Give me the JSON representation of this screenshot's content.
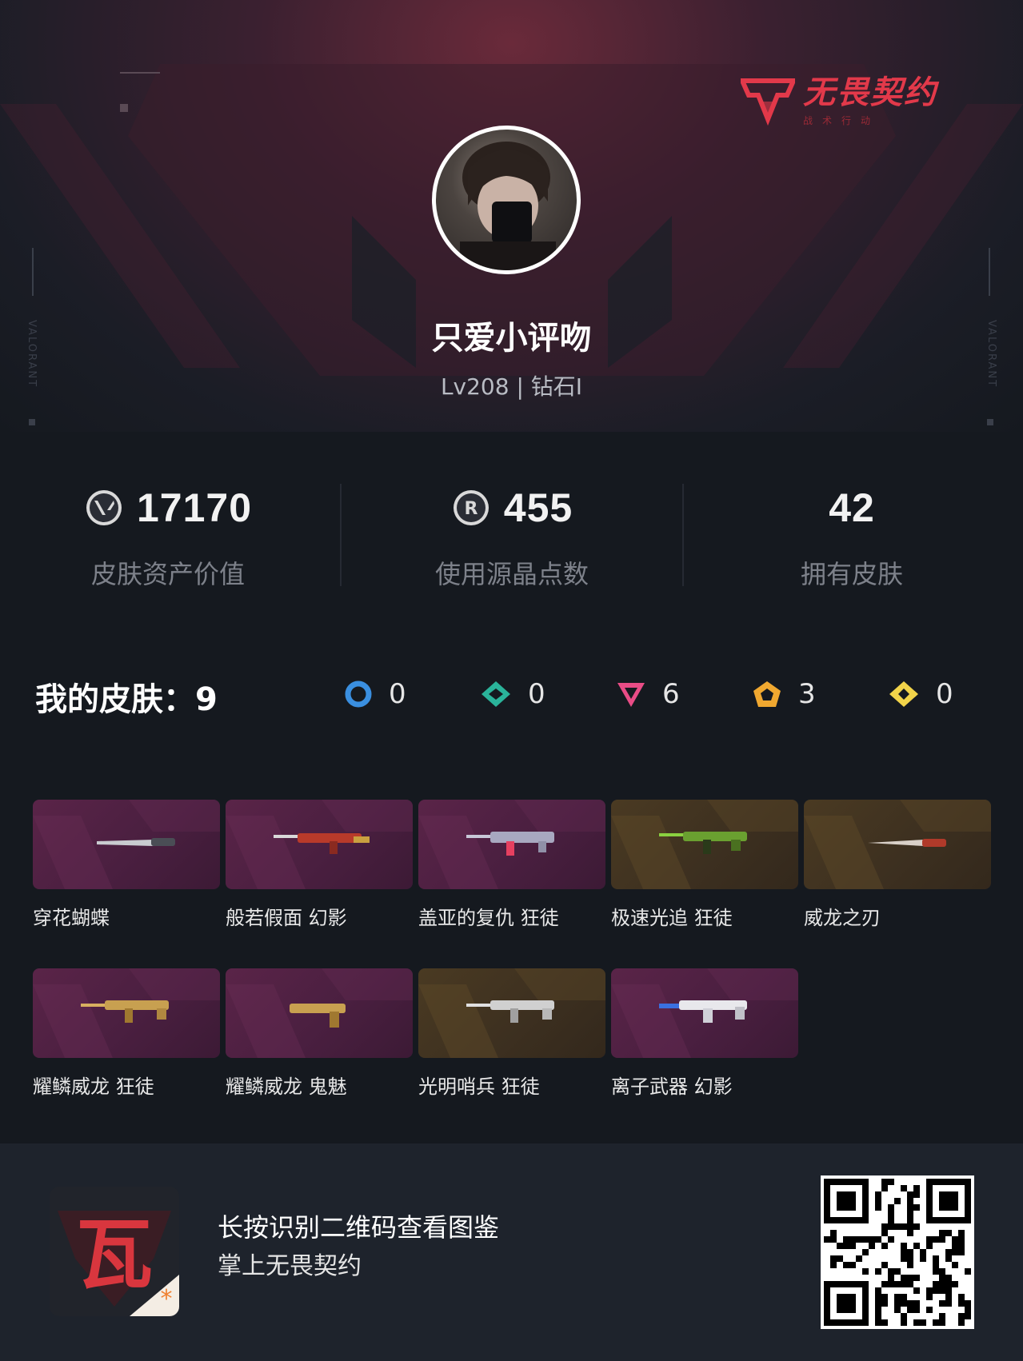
{
  "brand": {
    "title": "无畏契约",
    "subtitle": "战术行动"
  },
  "side_text": "VALORANT",
  "profile": {
    "username": "只爱小评吻",
    "level": "Lv208 | 钻石I"
  },
  "stats": [
    {
      "value": "17170",
      "label": "皮肤资产价值",
      "icon": "valorant-points-icon"
    },
    {
      "value": "455",
      "label": "使用源晶点数",
      "icon": "radianite-points-icon"
    },
    {
      "value": "42",
      "label": "拥有皮肤",
      "icon": ""
    }
  ],
  "skins_section": {
    "title": "我的皮肤：9",
    "rarities": [
      {
        "icon": "select-tier-icon",
        "color": "#3a8fe0",
        "count": "0"
      },
      {
        "icon": "deluxe-tier-icon",
        "color": "#2ab39a",
        "count": "0"
      },
      {
        "icon": "premium-tier-icon",
        "color": "#e94c86",
        "count": "6"
      },
      {
        "icon": "exclusive-tier-icon",
        "color": "#f0a830",
        "count": "3"
      },
      {
        "icon": "ultra-tier-icon",
        "color": "#f2d44a",
        "count": "0"
      }
    ],
    "items": [
      {
        "name": "穿花蝴蝶",
        "bg": "purple",
        "weapon": "knife"
      },
      {
        "name": "般若假面 幻影",
        "bg": "purple",
        "weapon": "rifle"
      },
      {
        "name": "盖亚的复仇 狂徒",
        "bg": "purple",
        "weapon": "rifle"
      },
      {
        "name": "极速光追 狂徒",
        "bg": "gold",
        "weapon": "rifle"
      },
      {
        "name": "威龙之刃",
        "bg": "gold",
        "weapon": "knife"
      },
      {
        "name": "耀鳞威龙 狂徒",
        "bg": "purple",
        "weapon": "rifle"
      },
      {
        "name": "耀鳞威龙 鬼魅",
        "bg": "purple",
        "weapon": "pistol"
      },
      {
        "name": "光明哨兵 狂徒",
        "bg": "gold",
        "weapon": "rifle"
      },
      {
        "name": "离子武器 幻影",
        "bg": "purple",
        "weapon": "rifle"
      }
    ]
  },
  "footer": {
    "line1": "长按识别二维码查看图鉴",
    "line2": "掌上无畏契约",
    "app_icon_text": "瓦"
  },
  "colors": {
    "accent": "#e2394a",
    "background": "#15191f",
    "footer": "#1e232c"
  }
}
